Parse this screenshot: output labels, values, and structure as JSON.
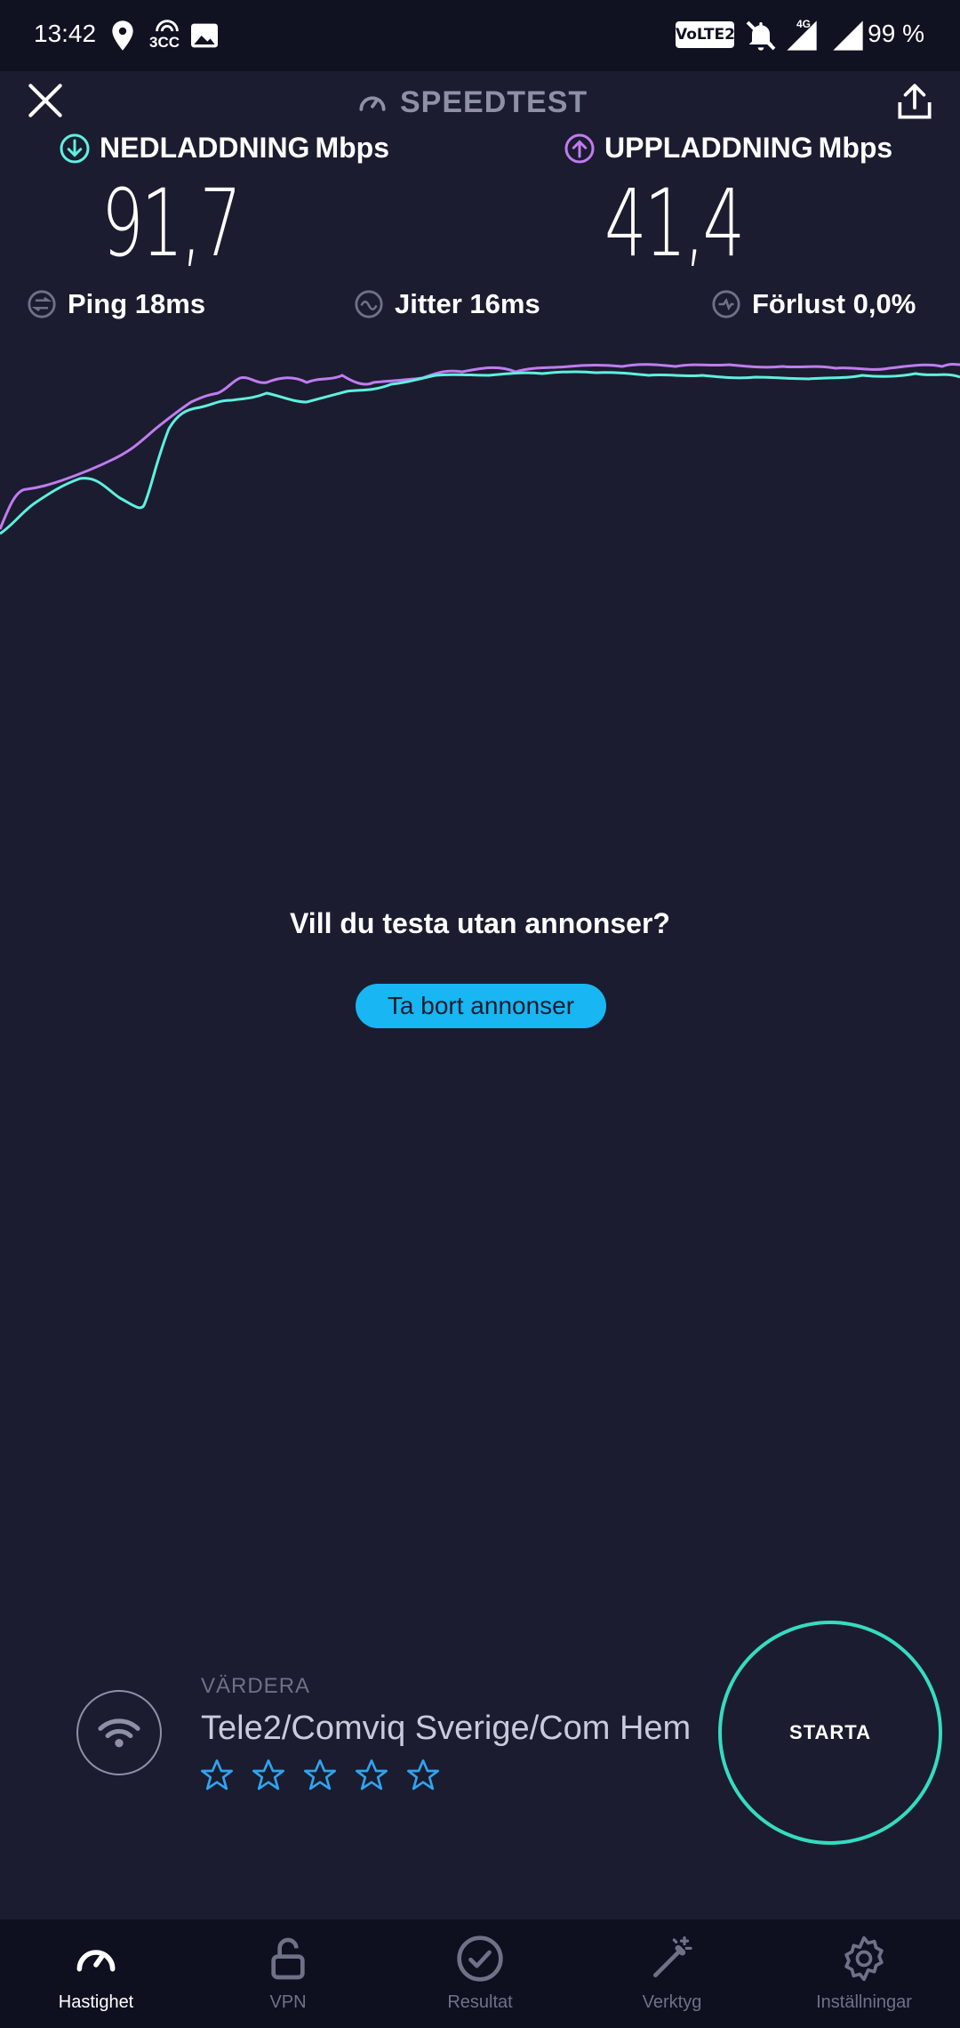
{
  "status_bar": {
    "time": "13:42",
    "network_label": "3CC",
    "volte": "VoLTE2",
    "net_type": "4G",
    "battery": "99 %"
  },
  "header": {
    "title": "SPEEDTEST",
    "icons": [
      "close-icon",
      "speedometer-icon",
      "share-icon"
    ]
  },
  "download": {
    "label": "NEDLADDNING",
    "unit": "Mbps",
    "value": "91,7",
    "color": "#5ef0e0"
  },
  "upload": {
    "label": "UPPLADDNING",
    "unit": "Mbps",
    "value": "41,4",
    "color": "#c07cf0"
  },
  "stats": {
    "ping": "Ping 18ms",
    "jitter": "Jitter 16ms",
    "loss": "Förlust 0,0%"
  },
  "ad": {
    "prompt": "Vill du testa utan annonser?",
    "button": "Ta bort annonser"
  },
  "provider": {
    "rate_label": "VÄRDERA",
    "name": "Tele2/Comviq Sverige/Com Hem",
    "stars_total": 5,
    "stars_filled": 0
  },
  "start_button": "STARTA",
  "nav": {
    "items": [
      {
        "label": "Hastighet",
        "icon": "speedometer-icon",
        "active": true
      },
      {
        "label": "VPN",
        "icon": "lock-icon",
        "active": false
      },
      {
        "label": "Resultat",
        "icon": "check-circle-icon",
        "active": false
      },
      {
        "label": "Verktyg",
        "icon": "magic-wand-icon",
        "active": false
      },
      {
        "label": "Inställningar",
        "icon": "gear-icon",
        "active": false
      }
    ]
  },
  "colors": {
    "background": "#1b1c2f",
    "accent_blue": "#18b6f2",
    "accent_teal": "#34dcc0"
  }
}
